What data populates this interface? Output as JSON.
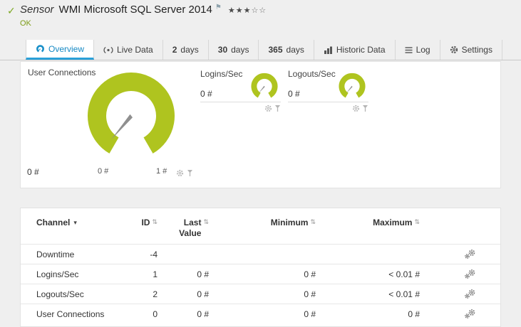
{
  "header": {
    "kind": "Sensor",
    "title": "WMI Microsoft SQL Server 2014",
    "status": "OK"
  },
  "icons": {
    "check": "✓",
    "flag": "⚑",
    "stars_filled": "★★★",
    "stars_empty": "☆☆",
    "sort": "⇅",
    "channel_sort": "▾"
  },
  "tabs": [
    {
      "label": "Overview"
    },
    {
      "label": "Live Data"
    },
    {
      "num": "2",
      "label": "days"
    },
    {
      "num": "30",
      "label": "days"
    },
    {
      "num": "365",
      "label": "days"
    },
    {
      "label": "Historic Data"
    },
    {
      "label": "Log"
    },
    {
      "label": "Settings"
    }
  ],
  "gauge_main": {
    "title": "User Connections",
    "value": "0 #",
    "scale_min": "0 #",
    "scale_max": "1 #"
  },
  "gauge_small": [
    {
      "title": "Logins/Sec",
      "value": "0 #"
    },
    {
      "title": "Logouts/Sec",
      "value": "0 #"
    }
  ],
  "table": {
    "col_channel": "Channel",
    "col_id": "ID",
    "col_last": "Last Value",
    "col_min": "Minimum",
    "col_max": "Maximum",
    "rows": [
      {
        "channel": "Downtime",
        "id": "-4",
        "last": "",
        "min": "",
        "max": ""
      },
      {
        "channel": "Logins/Sec",
        "id": "1",
        "last": "0 #",
        "min": "0 #",
        "max": "< 0.01 #"
      },
      {
        "channel": "Logouts/Sec",
        "id": "2",
        "last": "0 #",
        "min": "0 #",
        "max": "< 0.01 #"
      },
      {
        "channel": "User Connections",
        "id": "0",
        "last": "0 #",
        "min": "0 #",
        "max": "0 #"
      }
    ]
  },
  "colors": {
    "accent_green": "#afc41f",
    "accent_blue": "#2aa0d8",
    "status_ok_green": "#7c9c16"
  }
}
